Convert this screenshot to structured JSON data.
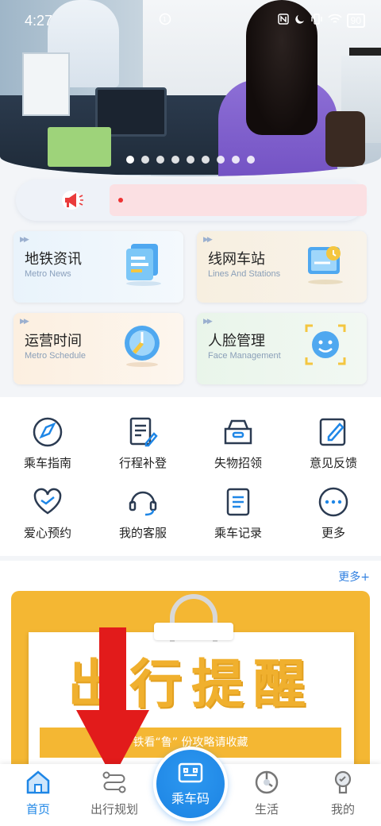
{
  "status_bar": {
    "time": "4:27",
    "indicators": [
      "nfc-icon",
      "moon-icon",
      "vibrate-icon",
      "wifi-icon"
    ],
    "battery": "90"
  },
  "carousel": {
    "slide_count": 9,
    "active_index": 0
  },
  "notice": {
    "icon": "megaphone-icon"
  },
  "feature_cards": [
    {
      "title": "地铁资讯",
      "subtitle": "Metro News",
      "icon": "news-stack-icon"
    },
    {
      "title": "线网车站",
      "subtitle": "Lines And Stations",
      "icon": "station-map-icon"
    },
    {
      "title": "运营时间",
      "subtitle": "Metro Schedule",
      "icon": "clock-dial-icon"
    },
    {
      "title": "人脸管理",
      "subtitle": "Face Management",
      "icon": "face-scan-icon"
    }
  ],
  "services": [
    {
      "label": "乘车指南",
      "icon": "compass-icon"
    },
    {
      "label": "行程补登",
      "icon": "edit-document-icon"
    },
    {
      "label": "失物招领",
      "icon": "lost-found-box-icon"
    },
    {
      "label": "意见反馈",
      "icon": "feedback-pen-icon"
    },
    {
      "label": "爱心预约",
      "icon": "heart-icon"
    },
    {
      "label": "我的客服",
      "icon": "headset-icon"
    },
    {
      "label": "乘车记录",
      "icon": "record-list-icon"
    },
    {
      "label": "更多",
      "icon": "more-dots-icon"
    }
  ],
  "promo": {
    "more_label": "更多+",
    "headline": "出行提醒",
    "caption": "铁看“鲁”   份攻略请收藏"
  },
  "bottom_nav": {
    "tabs": [
      {
        "label": "首页",
        "icon": "home-icon",
        "active": true
      },
      {
        "label": "出行规划",
        "icon": "route-plan-icon",
        "active": false
      },
      {
        "label": "乘车码",
        "icon": "qr-code-icon",
        "active": false
      },
      {
        "label": "生活",
        "icon": "life-icon",
        "active": false
      },
      {
        "label": "我的",
        "icon": "profile-icon",
        "active": false
      }
    ]
  },
  "colors": {
    "accent_blue": "#1e86e6",
    "promo_yellow": "#f4b733",
    "arrow_red": "#e21b1b"
  }
}
